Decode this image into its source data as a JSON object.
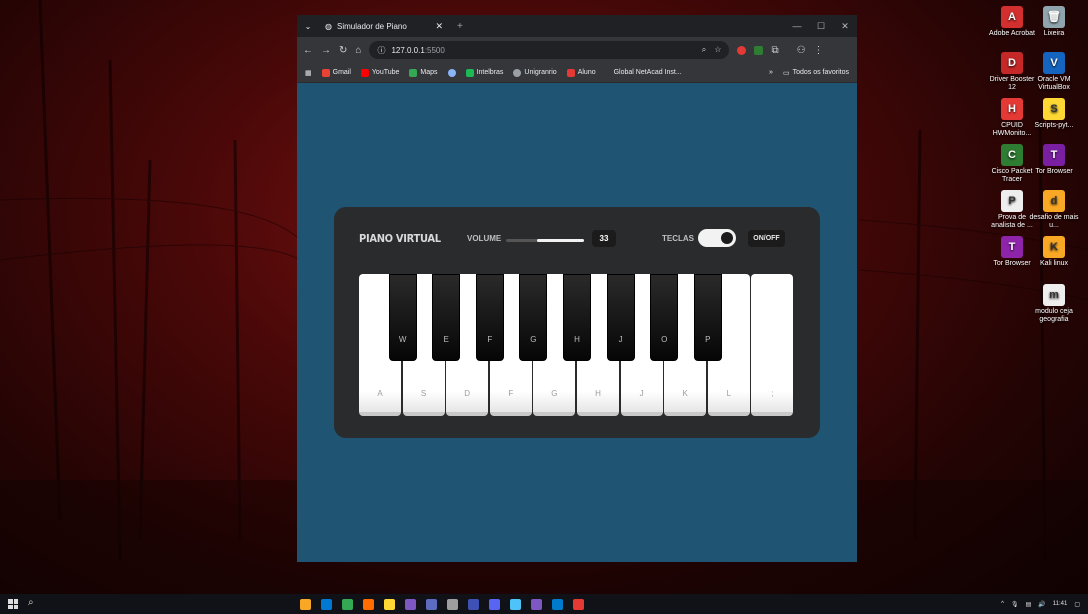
{
  "browser": {
    "tab_title": "Simulador de Piano",
    "url_host": "127.0.0.1",
    "url_port": ":5500",
    "win_minimize": "—",
    "win_maximize": "☐",
    "win_close": "✕",
    "new_tab": "+",
    "bookmarks": [
      {
        "label": "Gmail",
        "color": "#ea4335"
      },
      {
        "label": "YouTube",
        "color": "#ff0000"
      },
      {
        "label": "Maps",
        "color": "#34a853"
      },
      {
        "label": "",
        "color": "#8ab4f8"
      },
      {
        "label": "Intelbras",
        "color": "#1db954"
      },
      {
        "label": "Unigranrio",
        "color": "#9aa0a6"
      },
      {
        "label": "Aluno",
        "color": "#e53935"
      },
      {
        "label": "Global NetAcad Inst...",
        "color": ""
      }
    ],
    "bookmarks_overflow": "»",
    "all_bookmarks": "Todos os favoritos"
  },
  "piano": {
    "title": "PIANO VIRTUAL",
    "volume_label": "VOLUME",
    "volume_value": "33",
    "volume_level": 0.6,
    "keys_label": "TECLAS",
    "keys_toggle_on": true,
    "onoff_label": "ON/OFF",
    "white_keys": [
      "A",
      "S",
      "D",
      "F",
      "G",
      "H",
      "J",
      "K",
      "L",
      ";"
    ],
    "black_keys": [
      "W",
      "E",
      "F",
      "G",
      "H",
      "J",
      "O",
      "P"
    ]
  },
  "desktop_icons": [
    {
      "label": "Adobe Acrobat",
      "color": "#d32f2f",
      "glyph": "A"
    },
    {
      "label": "Lixeira",
      "color": "#90a4ae",
      "glyph": "🗑"
    },
    {
      "label": "Driver Booster 12",
      "color": "#c62828",
      "glyph": "D"
    },
    {
      "label": "Oracle VM VirtualBox",
      "color": "#1565c0",
      "glyph": "V"
    },
    {
      "label": "CPUID HWMonito...",
      "color": "#e53935",
      "glyph": "H"
    },
    {
      "label": "Scripts-pyt...",
      "color": "#fdd835",
      "glyph": "S"
    },
    {
      "label": "Cisco Packet Tracer",
      "color": "#2e7d32",
      "glyph": "C"
    },
    {
      "label": "Tor Browser",
      "color": "#7b1fa2",
      "glyph": "T"
    },
    {
      "label": "Prova de analista de ...",
      "color": "#eeeeee",
      "glyph": "P"
    },
    {
      "label": "desafio de mais u...",
      "color": "#f9a825",
      "glyph": "d"
    },
    {
      "label": "Tor Browser",
      "color": "#8e24aa",
      "glyph": "T"
    },
    {
      "label": "Kali linux",
      "color": "#f9a825",
      "glyph": "K"
    },
    {
      "label": "modulo ceja geografia",
      "color": "#eeeeee",
      "glyph": "m"
    }
  ],
  "taskbar": {
    "time": "11:41",
    "icon_colors": [
      "#f9a825",
      "#0078d4",
      "#34a853",
      "#ff6d00",
      "#fdd835",
      "#7e57c2",
      "#5c6bc0",
      "#9e9e9e",
      "#3f51b5",
      "#5865f2",
      "#4fc3f7",
      "#7e57c2",
      "#007acc",
      "#e53935"
    ]
  }
}
